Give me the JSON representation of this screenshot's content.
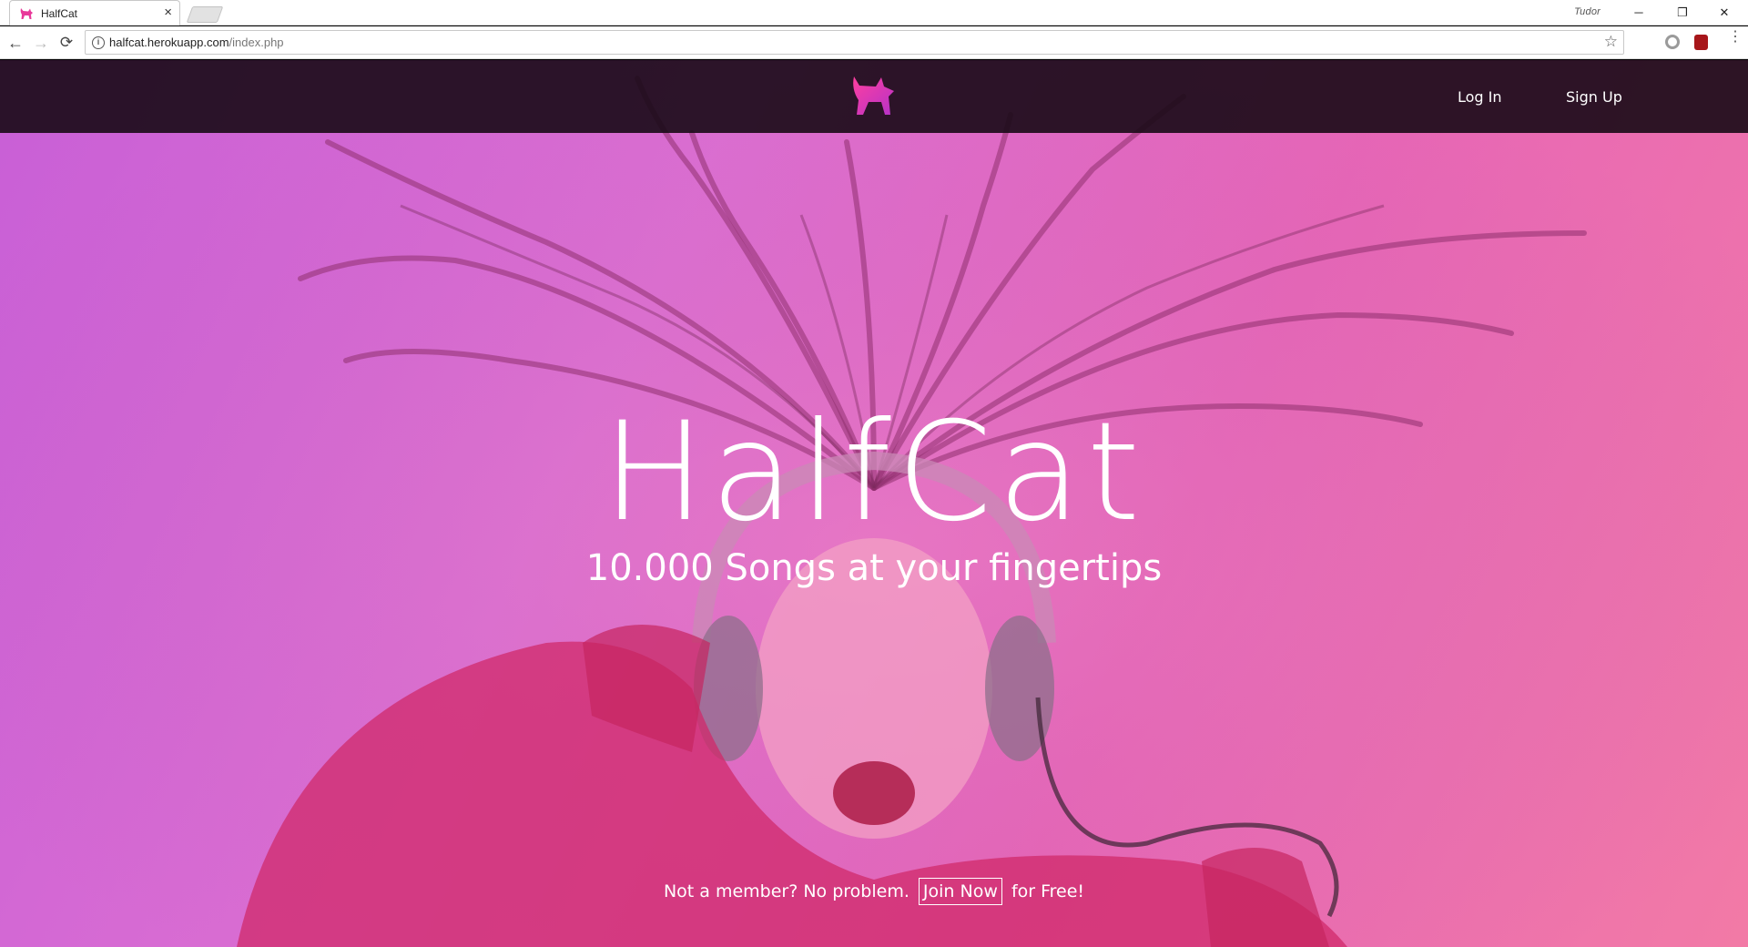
{
  "browser": {
    "tab_title": "HalfCat",
    "tab_close": "×",
    "profile_name": "Tudor",
    "url_host": "halfcat.herokuapp.com",
    "url_path": "/index.php",
    "window_min": "─",
    "window_restore": "❐",
    "window_close": "✕",
    "nav_back": "←",
    "nav_forward": "→",
    "nav_reload": "⟳",
    "info": "i",
    "star": "☆",
    "menu": "⋮"
  },
  "site": {
    "brand_color": "#e8399a",
    "nav": {
      "login": "Log In",
      "signup": "Sign Up"
    },
    "hero": {
      "title": "HalfCat",
      "subtitle": "10.000 Songs at your fingertips",
      "cta_prefix": "Not a member? No problem.",
      "cta_button": "Join Now",
      "cta_suffix": "for Free!"
    }
  }
}
